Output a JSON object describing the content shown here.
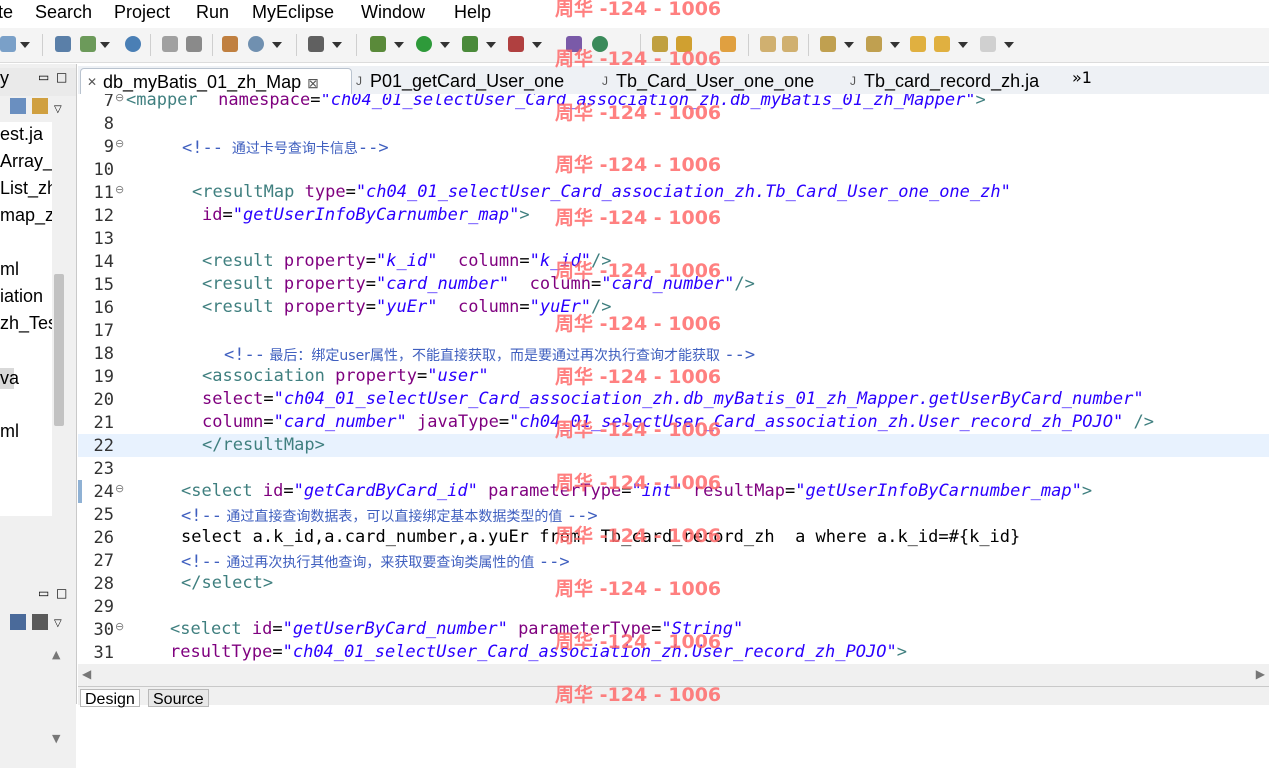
{
  "menu": [
    "te",
    "Search",
    "Project",
    "Run",
    "MyEclipse",
    "Window",
    "Help"
  ],
  "left_panel": {
    "tab_fragment": "y",
    "items": [
      "est.ja",
      "Array_",
      "List_zh",
      "map_z",
      "ml",
      "iation",
      "zh_Tes",
      "va",
      "ml"
    ]
  },
  "tabs": [
    {
      "label": "db_myBatis_01_zh_Map",
      "active": true
    },
    {
      "label": "P01_getCard_User_one",
      "active": false
    },
    {
      "label": "Tb_Card_User_one_one",
      "active": false
    },
    {
      "label": "Tb_card_record_zh.ja",
      "active": false
    }
  ],
  "tabs_overflow": "»1",
  "bottom_tabs": [
    "Design",
    "Source"
  ],
  "watermark": "周华 -124 - 1006",
  "code": {
    "l7": {
      "n": "7",
      "a": "<mapper",
      "b": "namespace",
      "c": "=",
      "d": "\"ch04_01_selectUser_Card_association_zh.db_myBatis_01_zh_Mapper\"",
      "e": ">"
    },
    "l8": {
      "n": "8"
    },
    "l9": {
      "n": "9",
      "a": "<!--",
      "b": "  通过卡号查询卡信息",
      "c": "-->"
    },
    "l10": {
      "n": "10"
    },
    "l11": {
      "n": "11",
      "a": "<resultMap",
      "b": "type",
      "c": "=",
      "d": "\"ch04_01_selectUser_Card_association_zh.Tb_Card_User_one_one_zh\""
    },
    "l12": {
      "n": "12",
      "b": "id",
      "c": "=",
      "d": "\"getUserInfoByCarnumber_map\"",
      "e": ">"
    },
    "l13": {
      "n": "13"
    },
    "l14": {
      "n": "14",
      "a": "<result",
      "b": "property",
      "c": "=",
      "d": "\"k_id\"",
      "f": "column",
      "g": "=",
      "h": "\"k_id\"",
      "e": "/>"
    },
    "l15": {
      "n": "15",
      "a": "<result",
      "b": "property",
      "c": "=",
      "d": "\"card_number\"",
      "f": "column",
      "g": "=",
      "h": "\"card_number\"",
      "e": "/>"
    },
    "l16": {
      "n": "16",
      "a": "<result",
      "b": "property",
      "c": "=",
      "d": "\"yuEr\"",
      "f": "column",
      "g": "=",
      "h": "\"yuEr\"",
      "e": "/>"
    },
    "l17": {
      "n": "17"
    },
    "l18": {
      "n": "18",
      "a": "<!--",
      "b": " 最后：绑定user属性，不能直接获取，而是要通过再次执行查询才能获取 ",
      "c": "-->"
    },
    "l19": {
      "n": "19",
      "a": "<association",
      "b": "property",
      "c": "=",
      "d": "\"user\""
    },
    "l20": {
      "n": "20",
      "b": "select",
      "c": "=",
      "d": "\"ch04_01_selectUser_Card_association_zh.db_myBatis_01_zh_Mapper.getUserByCard_number\""
    },
    "l21": {
      "n": "21",
      "b": "column",
      "c": "=",
      "d": "\"card_number\"",
      "f": "javaType",
      "g": "=",
      "h": "\"ch04_01_selectUser_Card_association_zh.User_record_zh_POJO\"",
      "e": "/>"
    },
    "l22": {
      "n": "22",
      "a": "</resultMap",
      "e": ">"
    },
    "l23": {
      "n": "23"
    },
    "l24": {
      "n": "24",
      "a": "<select",
      "b": "id",
      "c": "=",
      "d": "\"getCardByCard_id\"",
      "f": "parameterType",
      "g": "=",
      "h": "\"int\"",
      "i": "resultMap",
      "j": "=",
      "k": "\"getUserInfoByCarnumber_map\"",
      "e": ">"
    },
    "l25": {
      "n": "25",
      "a": "<!--",
      "b": " 通过直接查询数据表，可以直接绑定基本数据类型的值 ",
      "c": "-->"
    },
    "l26": {
      "n": "26",
      "t": "select a.k_id,a.card_number,a.yuEr from  Tb_card_record_zh  a where a.k_id=#{k_id}"
    },
    "l27": {
      "n": "27",
      "a": "<!--",
      "b": " 通过再次执行其他查询，来获取要查询类属性的值 ",
      "c": "-->"
    },
    "l28": {
      "n": "28",
      "a": "</select",
      "e": ">"
    },
    "l29": {
      "n": "29"
    },
    "l30": {
      "n": "30",
      "a": "<select",
      "b": "id",
      "c": "=",
      "d": "\"getUserByCard_number\"",
      "f": "parameterType",
      "g": "=",
      "h": "\"String\""
    },
    "l31": {
      "n": "31",
      "b": "resultType",
      "c": "=",
      "d": "\"ch04_01_selectUser_Card_association_zh.User_record_zh_POJO\"",
      "e": ">"
    }
  }
}
